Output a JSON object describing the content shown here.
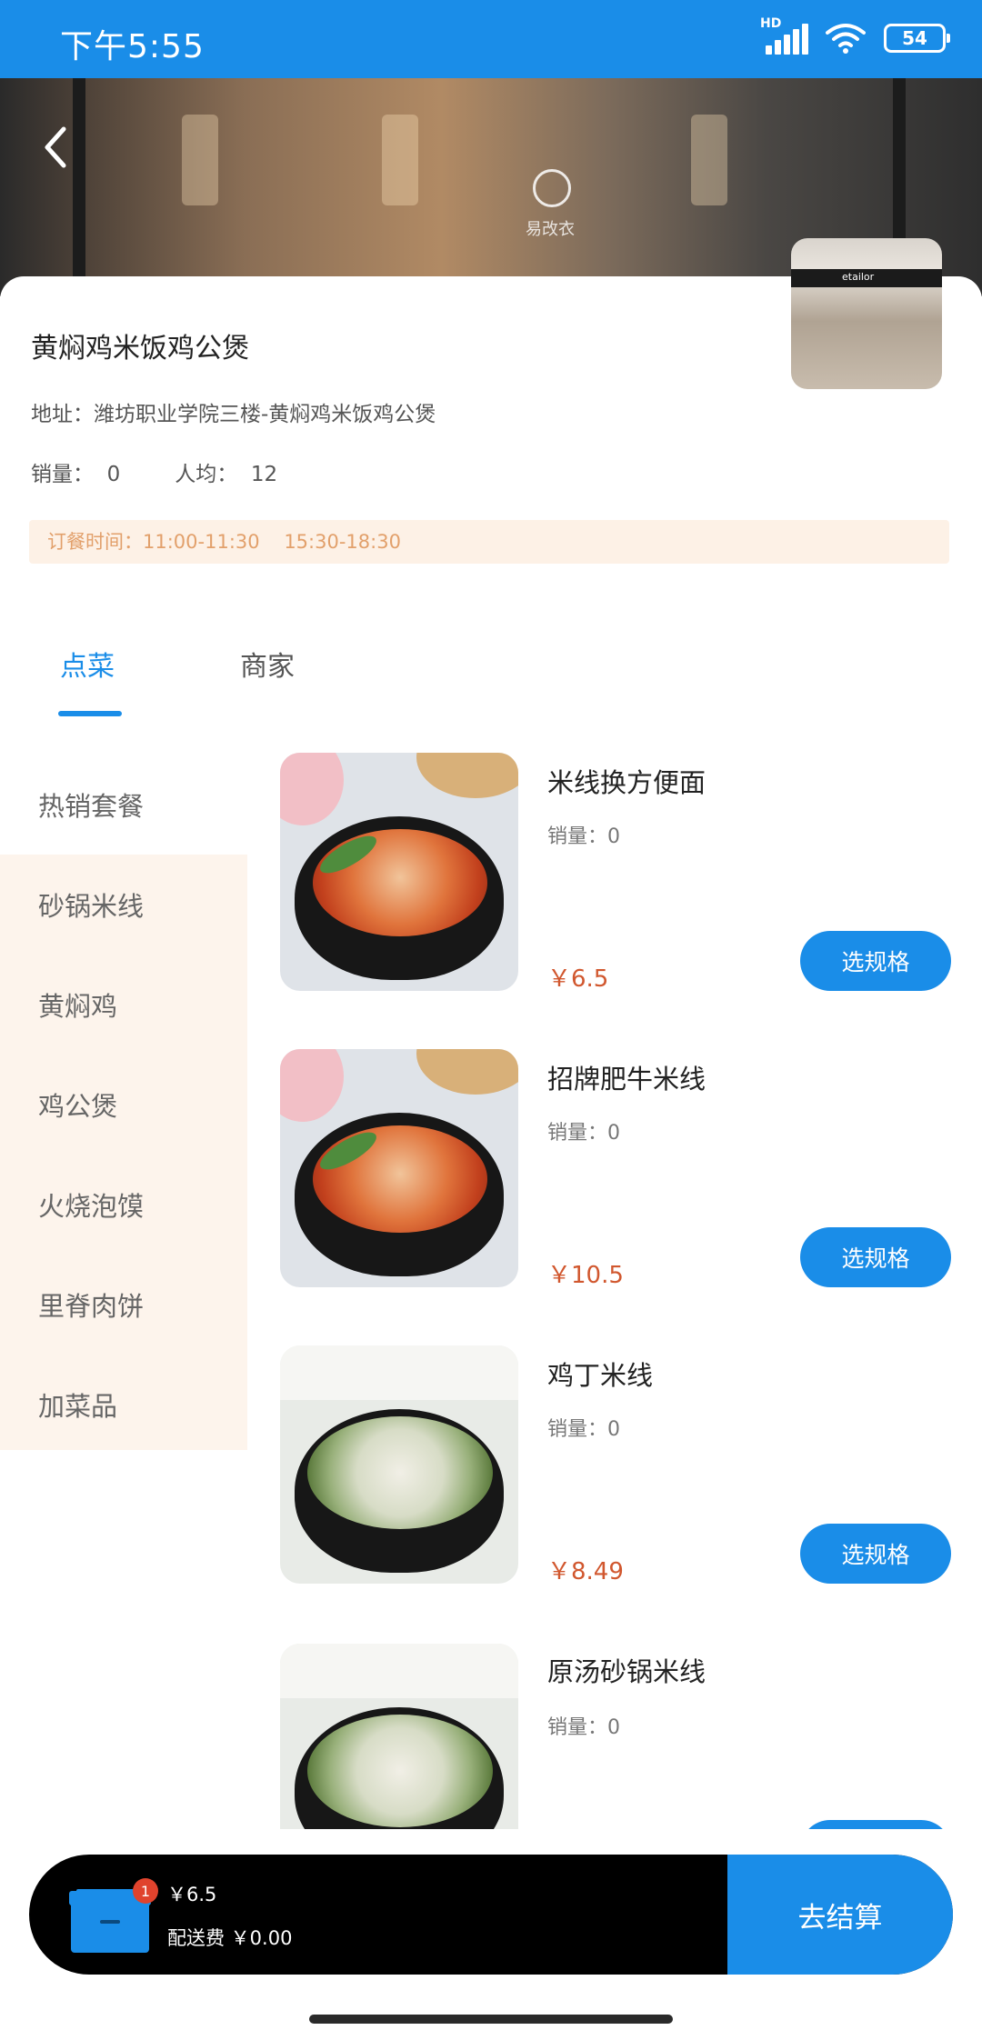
{
  "status_bar": {
    "time": "下午5:55",
    "network": "HD",
    "battery": "54"
  },
  "store": {
    "name": "黄焖鸡米饭鸡公煲",
    "address": "地址：潍坊职业学院三楼-黄焖鸡米饭鸡公煲",
    "sales_label": "销量：",
    "sales_value": "0",
    "avg_label": "人均：",
    "avg_value": "12",
    "order_time": "订餐时间：11:00-11:30    15:30-18:30",
    "thumb_text": "etailor"
  },
  "hero": {
    "sign_text": "易改衣"
  },
  "tabs": [
    {
      "label": "点菜",
      "active": true
    },
    {
      "label": "商家",
      "active": false
    }
  ],
  "categories": [
    {
      "label": "热销套餐",
      "selected": true
    },
    {
      "label": "砂锅米线",
      "selected": false
    },
    {
      "label": "黄焖鸡",
      "selected": false
    },
    {
      "label": "鸡公煲",
      "selected": false
    },
    {
      "label": "火烧泡馍",
      "selected": false
    },
    {
      "label": "里脊肉饼",
      "selected": false
    },
    {
      "label": "加菜品",
      "selected": false
    }
  ],
  "foods": [
    {
      "name": "米线换方便面",
      "sales": "销量：0",
      "price": "￥6.5",
      "button": "选规格",
      "image": "red-noodle-pot"
    },
    {
      "name": "招牌肥牛米线",
      "sales": "销量：0",
      "price": "￥10.5",
      "button": "选规格",
      "image": "red-noodle-pot"
    },
    {
      "name": "鸡丁米线",
      "sales": "销量：0",
      "price": "￥8.49",
      "button": "选规格",
      "image": "clear-noodle-pot"
    },
    {
      "name": "原汤砂锅米线",
      "sales": "销量：0",
      "price": "",
      "button": "",
      "image": "clear-noodle-pot"
    }
  ],
  "cart": {
    "badge": "1",
    "total": "￥6.5",
    "delivery_fee": "配送费 ￥0.00",
    "checkout": "去结算"
  },
  "colors": {
    "primary": "#1a8de8",
    "price": "#d1572e",
    "order_time_bg": "#fdf1e6",
    "order_time_text": "#e2a06b",
    "category_bg": "#fdf4ec",
    "badge": "#e0432d"
  }
}
